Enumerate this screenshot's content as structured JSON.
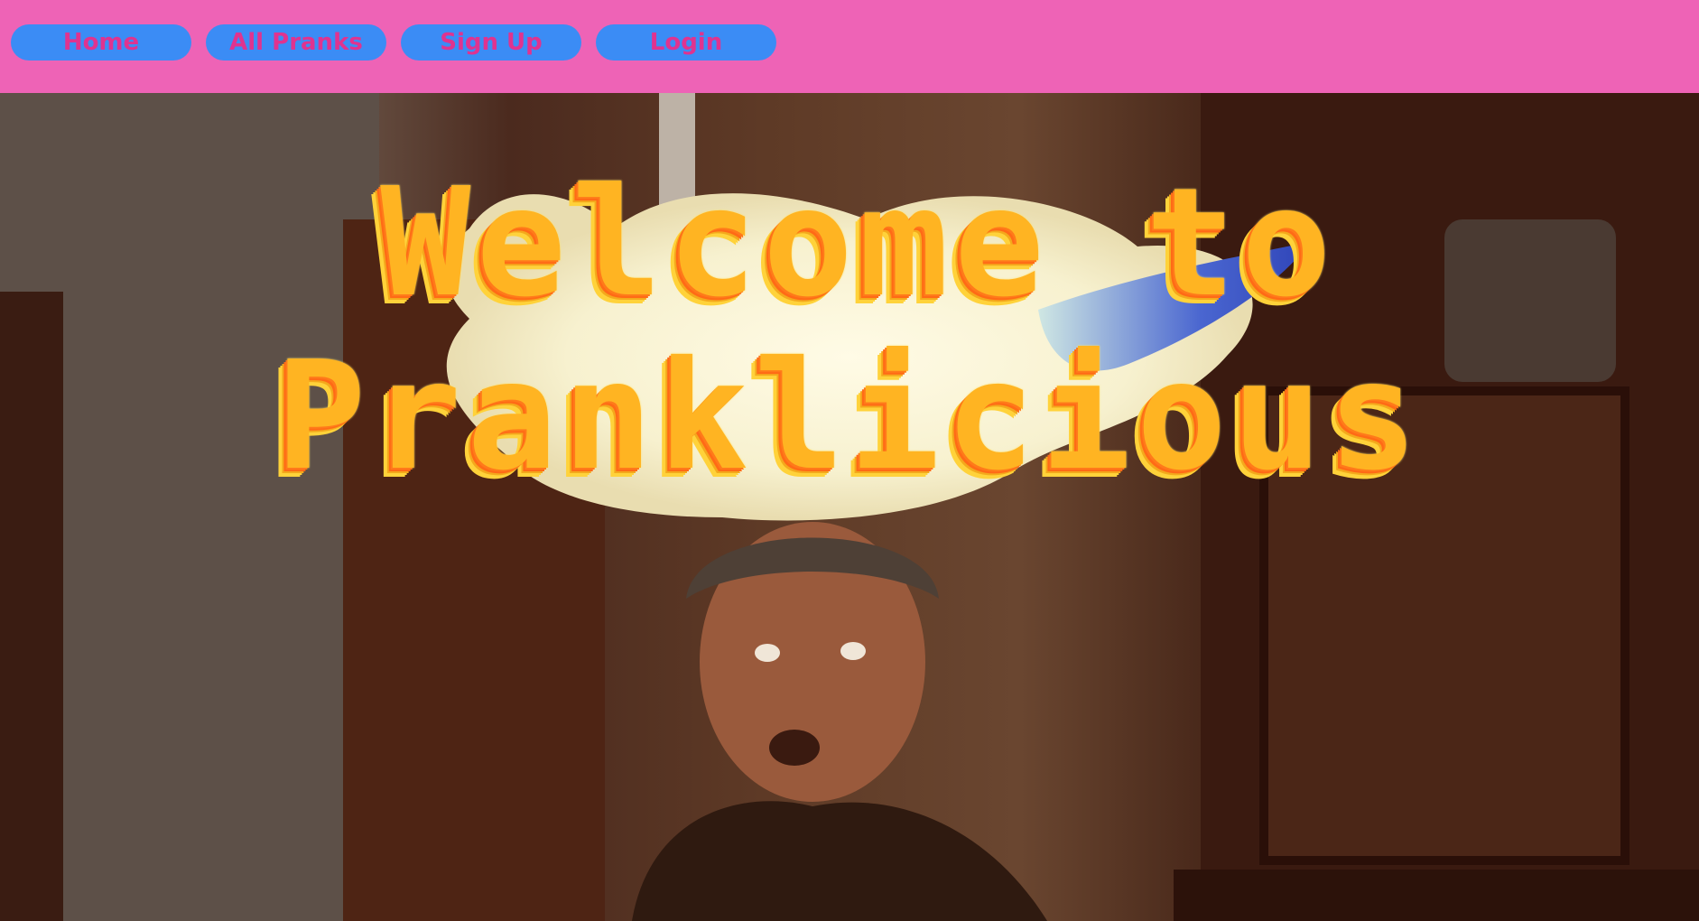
{
  "nav": {
    "items": [
      {
        "label": "Home"
      },
      {
        "label": "All Pranks"
      },
      {
        "label": "Sign Up"
      },
      {
        "label": "Login"
      }
    ]
  },
  "hero": {
    "title_line1": "Welcome to",
    "title_line2": "Pranklicious",
    "image_desc": "harry-head-fire-photo"
  },
  "colors": {
    "navbar_bg": "#ee63b6",
    "nav_button_bg": "#3b8cf5",
    "nav_button_text": "#e0338f",
    "title_face": "#ffb422",
    "title_depth": "#ff7a1a",
    "flame": "#fbf8dc",
    "torch_flame": "#3b4fc4"
  }
}
